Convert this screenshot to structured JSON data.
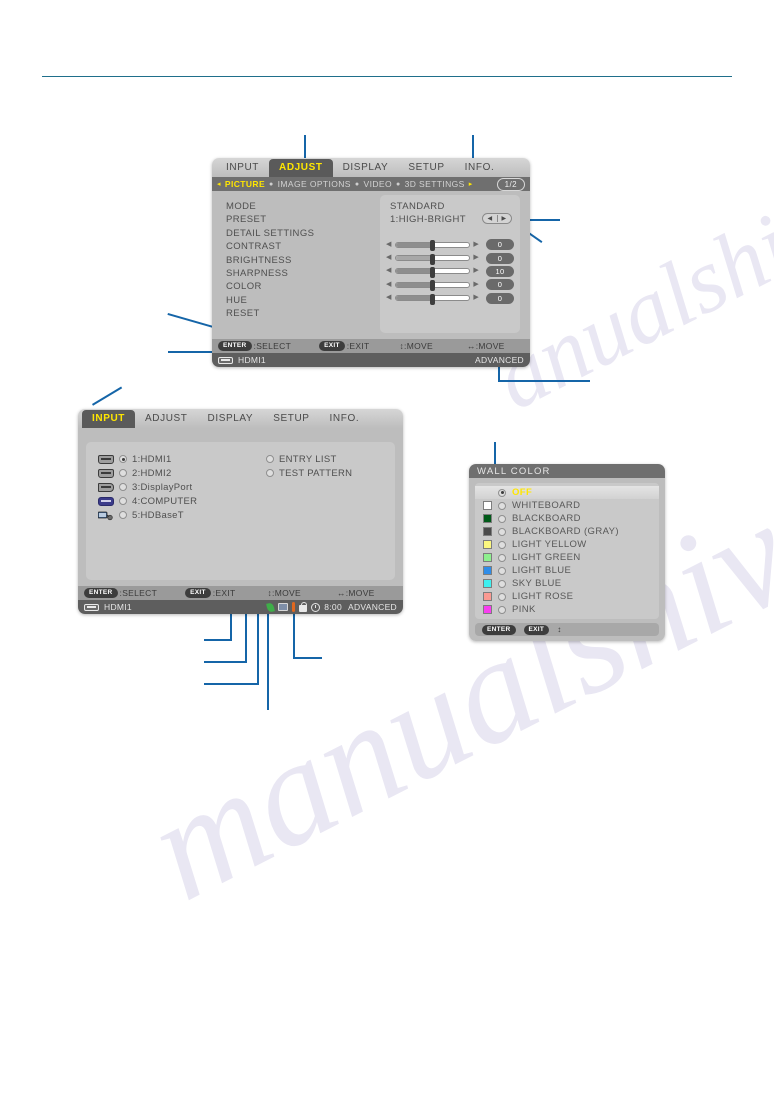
{
  "watermark": {
    "line1": "anualshive.com",
    "line2": "manualshive"
  },
  "panel_adjust": {
    "tabs": [
      "INPUT",
      "ADJUST",
      "DISPLAY",
      "SETUP",
      "INFO."
    ],
    "active_tab": "ADJUST",
    "subtabs": [
      "PICTURE",
      "IMAGE OPTIONS",
      "VIDEO",
      "3D SETTINGS"
    ],
    "active_subtab": "PICTURE",
    "page_indicator": "1/2",
    "left_items": [
      "MODE",
      "PRESET",
      "DETAIL SETTINGS",
      "CONTRAST",
      "BRIGHTNESS",
      "SHARPNESS",
      "COLOR",
      "HUE",
      "RESET"
    ],
    "mode_value": "STANDARD",
    "preset_value": "1:HIGH-BRIGHT",
    "left_arrow": "◂",
    "right_arrow": "▸",
    "sliders": [
      {
        "name": "CONTRAST",
        "value": "0",
        "percent": 50
      },
      {
        "name": "BRIGHTNESS",
        "value": "0",
        "percent": 50
      },
      {
        "name": "SHARPNESS",
        "value": "10",
        "percent": 50
      },
      {
        "name": "COLOR",
        "value": "0",
        "percent": 50
      },
      {
        "name": "HUE",
        "value": "0",
        "percent": 50
      }
    ],
    "footer": {
      "enter_pill": "ENTER",
      "enter_label": ":SELECT",
      "exit_pill": "EXIT",
      "exit_label": ":EXIT",
      "move_vert": "↕:MOVE",
      "move_horz": "↔:MOVE"
    },
    "status": {
      "source": "HDMI1",
      "mode": "ADVANCED"
    }
  },
  "panel_input": {
    "tabs": [
      "INPUT",
      "ADJUST",
      "DISPLAY",
      "SETUP",
      "INFO."
    ],
    "active_tab": "INPUT",
    "sources": [
      {
        "label": "1:HDMI1",
        "icon": "hdmi-connector-icon",
        "selected": true
      },
      {
        "label": "2:HDMI2",
        "icon": "hdmi-connector-icon",
        "selected": false
      },
      {
        "label": "3:DisplayPort",
        "icon": "displayport-connector-icon",
        "selected": false
      },
      {
        "label": "4:COMPUTER",
        "icon": "vga-connector-icon",
        "selected": false
      },
      {
        "label": "5:HDBaseT",
        "icon": "network-connector-icon",
        "selected": false
      }
    ],
    "extras": [
      {
        "label": "ENTRY LIST",
        "selected": false
      },
      {
        "label": "TEST PATTERN",
        "selected": false
      }
    ],
    "footer": {
      "enter_pill": "ENTER",
      "enter_label": ":SELECT",
      "exit_pill": "EXIT",
      "exit_label": ":EXIT",
      "move_vert": "↕:MOVE",
      "move_horz": "↔:MOVE"
    },
    "status": {
      "source": "HDMI1",
      "mode": "ADVANCED",
      "time": "8:00",
      "icons": [
        "eco-leaf-icon",
        "image-icon",
        "thermometer-icon",
        "lock-icon",
        "clock-icon"
      ]
    }
  },
  "panel_wall_color": {
    "title": "WALL COLOR",
    "items": [
      {
        "label": "OFF",
        "swatch": "none",
        "selected": true
      },
      {
        "label": "WHITEBOARD",
        "swatch": "#ffffff",
        "selected": false
      },
      {
        "label": "BLACKBOARD",
        "swatch": "#005a18",
        "selected": false
      },
      {
        "label": "BLACKBOARD (GRAY)",
        "swatch": "#4a4a4a",
        "selected": false
      },
      {
        "label": "LIGHT YELLOW",
        "swatch": "#fbf77f",
        "selected": false
      },
      {
        "label": "LIGHT GREEN",
        "swatch": "#8ef08e",
        "selected": false
      },
      {
        "label": "LIGHT BLUE",
        "swatch": "#2f8de8",
        "selected": false
      },
      {
        "label": "SKY BLUE",
        "swatch": "#3ff0f0",
        "selected": false
      },
      {
        "label": "LIGHT ROSE",
        "swatch": "#fa9a92",
        "selected": false
      },
      {
        "label": "PINK",
        "swatch": "#f83ef0",
        "selected": false
      }
    ],
    "footer": {
      "enter_pill": "ENTER",
      "exit_pill": "EXIT",
      "move": "↕"
    }
  },
  "colors": {
    "leader": "#1565a8",
    "rule": "#1f6f8b",
    "highlight": "#ffe600"
  }
}
